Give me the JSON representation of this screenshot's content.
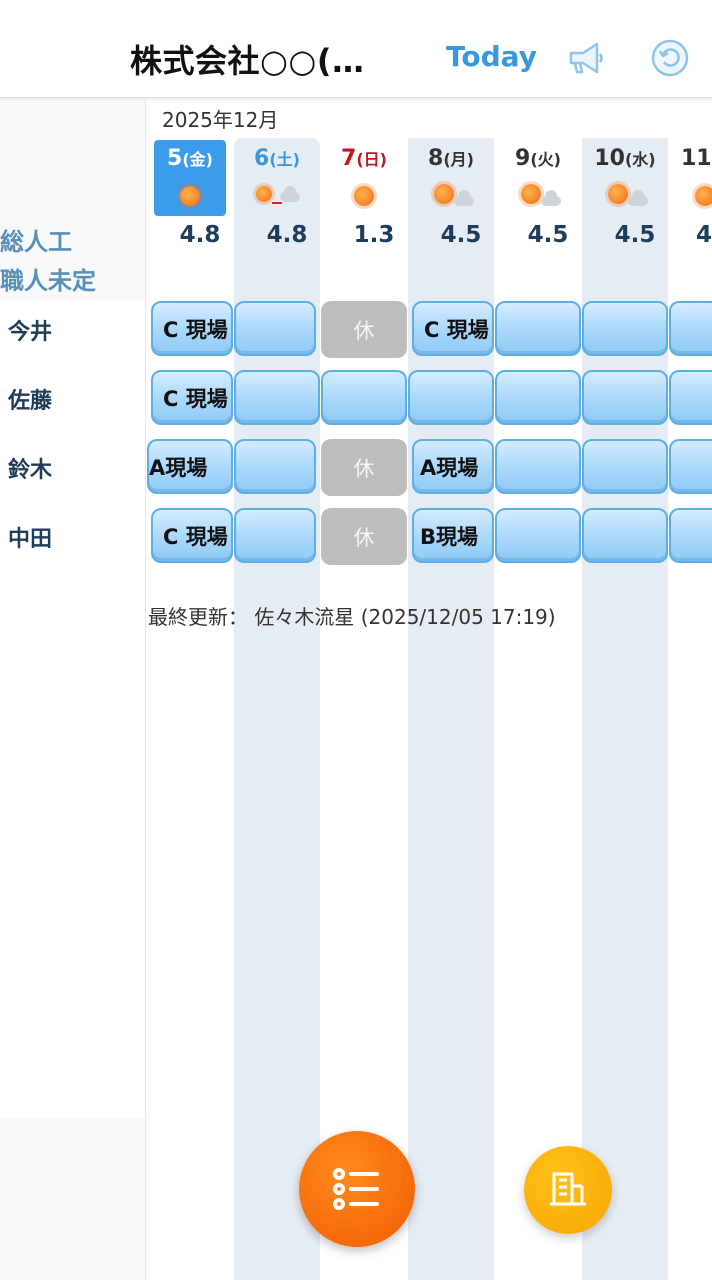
{
  "header": {
    "company": "株式会社○○(…",
    "today_label": "Today",
    "icons": [
      "megaphone-icon",
      "undo-icon"
    ]
  },
  "calendar": {
    "month": "2025年12月",
    "labels": {
      "total": "総人工",
      "unassigned": "職人未定"
    },
    "days": [
      {
        "num": "5",
        "wd": "(金)",
        "total": "4.8",
        "weather": "sunny",
        "color": "#ffffff"
      },
      {
        "num": "6",
        "wd": "(土)",
        "total": "4.8",
        "weather": "sunny-to-cloudy",
        "color": "#3a97d9"
      },
      {
        "num": "7",
        "wd": "(日)",
        "total": "1.3",
        "weather": "sunny",
        "color": "#c0191f"
      },
      {
        "num": "8",
        "wd": "(月)",
        "total": "4.5",
        "weather": "sunny-cloudy",
        "color": "#333333"
      },
      {
        "num": "9",
        "wd": "(火)",
        "total": "4.5",
        "weather": "sunny-cloudy",
        "color": "#333333"
      },
      {
        "num": "10",
        "wd": "(水)",
        "total": "4.5",
        "weather": "sunny-cloudy",
        "color": "#333333"
      },
      {
        "num": "11",
        "wd": "",
        "total": "4",
        "weather": "sunny",
        "color": "#333333"
      }
    ],
    "workers": [
      {
        "name": "今井",
        "cells": [
          "C 現場",
          "",
          "休",
          "C 現場",
          "",
          "",
          ""
        ]
      },
      {
        "name": "佐藤",
        "cells": [
          "C 現場",
          "",
          "",
          "",
          "",
          "",
          ""
        ]
      },
      {
        "name": "鈴木",
        "cells": [
          "A現場",
          "",
          "休",
          "A現場",
          "",
          "",
          ""
        ]
      },
      {
        "name": "中田",
        "cells": [
          "C 現場",
          "",
          "休",
          "B現場",
          "",
          "",
          ""
        ]
      }
    ],
    "off_label": "休",
    "last_updated": "最終更新： 佐々木流星 (2025/12/05 17:19)"
  },
  "fabs": {
    "main_icon": "list-icon",
    "sub_icon": "building-icon"
  }
}
